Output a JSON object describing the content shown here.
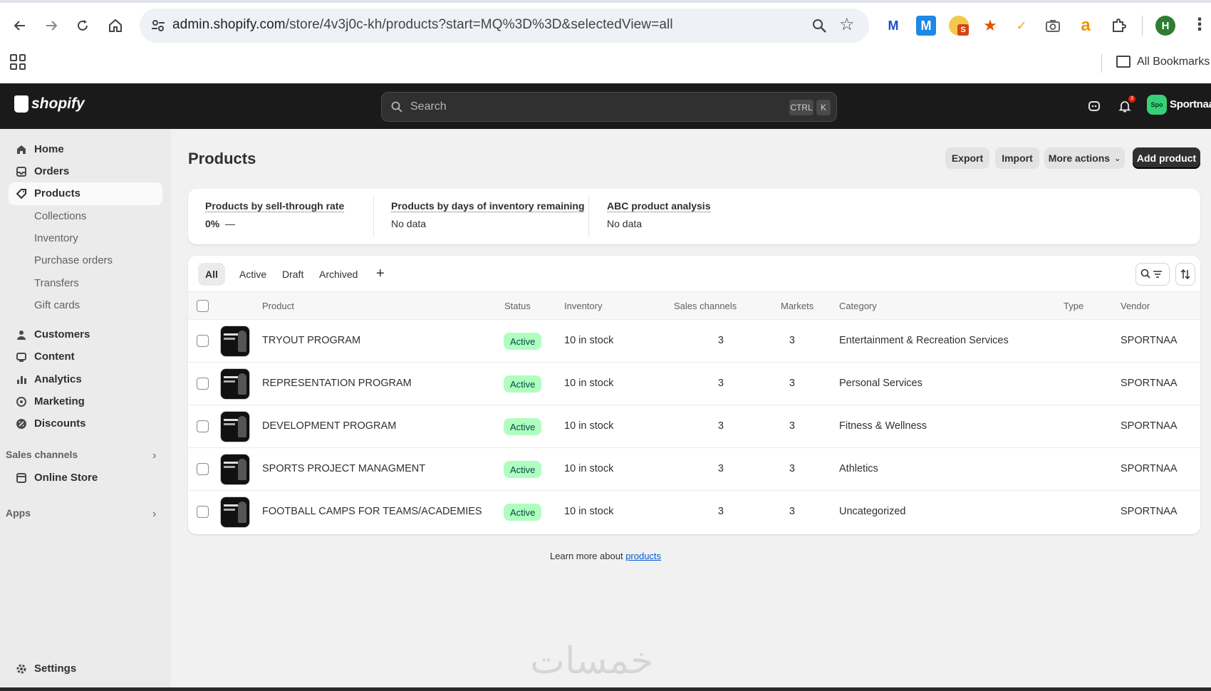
{
  "browser": {
    "url_host": "admin.shopify.com",
    "url_path": "/store/4v3j0c-kh/products?start=MQ%3D%3D&selectedView=all",
    "bookmarks_label": "All Bookmarks",
    "profile_initial": "H",
    "extensions": [
      "malwarebytes-icon",
      "m-extension-icon",
      "s-badge-extension-icon",
      "star-extension-icon",
      "person-check-extension-icon",
      "camera-extension-icon",
      "amazon-extension-icon",
      "puzzle-icon"
    ],
    "extension_badge": "S"
  },
  "topbar": {
    "brand": "shopify",
    "search_placeholder": "Search",
    "kbd_ctrl": "CTRL",
    "kbd_k": "K",
    "notification_count": "3",
    "store_avatar": "Spo",
    "store_name": "Sportnaa"
  },
  "sidebar": {
    "items": [
      {
        "label": "Home",
        "icon": "home-icon"
      },
      {
        "label": "Orders",
        "icon": "inbox-icon"
      },
      {
        "label": "Products",
        "icon": "tag-icon",
        "active": true
      },
      {
        "label": "Collections",
        "sub": true
      },
      {
        "label": "Inventory",
        "sub": true
      },
      {
        "label": "Purchase orders",
        "sub": true
      },
      {
        "label": "Transfers",
        "sub": true
      },
      {
        "label": "Gift cards",
        "sub": true
      },
      {
        "label": "Customers",
        "icon": "person-icon"
      },
      {
        "label": "Content",
        "icon": "content-icon"
      },
      {
        "label": "Analytics",
        "icon": "bar-chart-icon"
      },
      {
        "label": "Marketing",
        "icon": "target-icon"
      },
      {
        "label": "Discounts",
        "icon": "discount-icon"
      }
    ],
    "sales_channels_label": "Sales channels",
    "online_store_label": "Online Store",
    "apps_label": "Apps",
    "settings_label": "Settings"
  },
  "page": {
    "title": "Products",
    "export_label": "Export",
    "import_label": "Import",
    "more_actions_label": "More actions",
    "add_product_label": "Add product"
  },
  "analytics": {
    "m1_title": "Products by sell-through rate",
    "m1_value": "0%",
    "m1_dash": "—",
    "m2_title": "Products by days of inventory remaining",
    "m2_value": "No data",
    "m3_title": "ABC product analysis",
    "m3_value": "No data"
  },
  "tabs": [
    "All",
    "Active",
    "Draft",
    "Archived"
  ],
  "tab_add": "+",
  "table": {
    "headers": {
      "product": "Product",
      "status": "Status",
      "inventory": "Inventory",
      "sales_channels": "Sales channels",
      "markets": "Markets",
      "category": "Category",
      "type": "Type",
      "vendor": "Vendor"
    },
    "rows": [
      {
        "product": "TRYOUT PROGRAM",
        "status": "Active",
        "inventory": "10 in stock",
        "sales_channels": "3",
        "markets": "3",
        "category": "Entertainment & Recreation Services",
        "type": "",
        "vendor": "SPORTNAA"
      },
      {
        "product": "REPRESENTATION PROGRAM",
        "status": "Active",
        "inventory": "10 in stock",
        "sales_channels": "3",
        "markets": "3",
        "category": "Personal Services",
        "type": "",
        "vendor": "SPORTNAA"
      },
      {
        "product": "DEVELOPMENT PROGRAM",
        "status": "Active",
        "inventory": "10 in stock",
        "sales_channels": "3",
        "markets": "3",
        "category": "Fitness & Wellness",
        "type": "",
        "vendor": "SPORTNAA"
      },
      {
        "product": "SPORTS PROJECT MANAGMENT",
        "status": "Active",
        "inventory": "10 in stock",
        "sales_channels": "3",
        "markets": "3",
        "category": "Athletics",
        "type": "",
        "vendor": "SPORTNAA"
      },
      {
        "product": "FOOTBALL CAMPS FOR TEAMS/ACADEMIES",
        "status": "Active",
        "inventory": "10 in stock",
        "sales_channels": "3",
        "markets": "3",
        "category": "Uncategorized",
        "type": "",
        "vendor": "SPORTNAA"
      }
    ]
  },
  "footer": {
    "learn_prefix": "Learn more about",
    "learn_link": "products"
  },
  "watermark": "خمسات",
  "colors": {
    "topbar": "#1a1a1a",
    "active_badge_bg": "#affebf",
    "active_badge_text": "#014b40",
    "link": "#005bd3",
    "primary_button": "#303030"
  }
}
